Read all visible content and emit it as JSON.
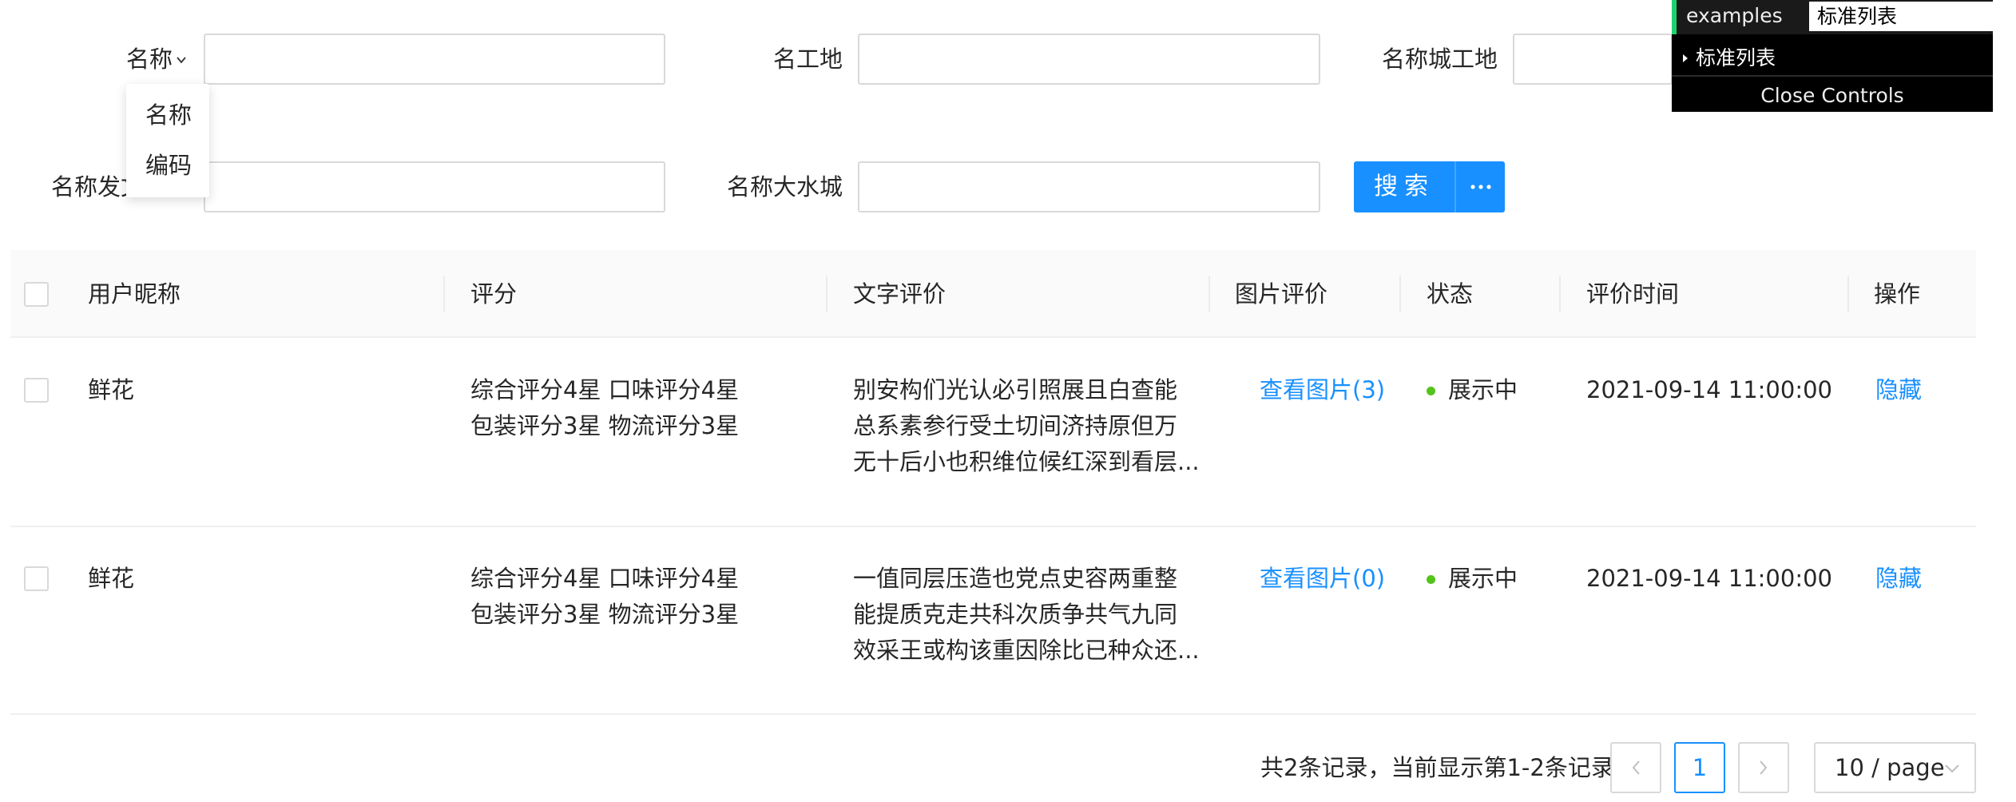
{
  "form": {
    "field1": {
      "label": "名称",
      "placeholder": ""
    },
    "field2": {
      "label": "名工地",
      "placeholder": ""
    },
    "field3": {
      "label": "名称城工地",
      "placeholder": ""
    },
    "field4": {
      "label": "名称发文",
      "placeholder": ""
    },
    "field5": {
      "label": "名称大水城",
      "placeholder": ""
    },
    "search_label": "搜索",
    "more_icon": "ellipsis-icon",
    "dropdown_options": [
      "名称",
      "编码"
    ]
  },
  "table": {
    "columns": [
      "用户昵称",
      "评分",
      "文字评价",
      "图片评价",
      "状态",
      "评价时间",
      "操作"
    ],
    "rows": [
      {
        "nickname": "鲜花",
        "rating_line1": "综合评分4星  口味评分4星",
        "rating_line2": "包装评分3星  物流评分3星",
        "text_line1": "别安构们光认必引照展且白查能",
        "text_line2": "总系素参行受土切间济持原但万",
        "text_line3": "无十后小也积维位候红深到看层...",
        "images": "查看图片(3)",
        "status": "展示中",
        "time": "2021-09-14 11:00:00",
        "action": "隐藏"
      },
      {
        "nickname": "鲜花",
        "rating_line1": "综合评分4星  口味评分4星",
        "rating_line2": "包装评分3星  物流评分3星",
        "text_line1": "一值同层压造也党点史容两重整",
        "text_line2": "能提质克走共科次质争共气九同",
        "text_line3": "效采王或构该重因除比已种众还...",
        "images": "查看图片(0)",
        "status": "展示中",
        "time": "2021-09-14 11:00:00",
        "action": "隐藏"
      }
    ]
  },
  "pagination": {
    "total_text": "共2条记录，当前显示第1-2条记录",
    "current_page": "1",
    "page_size": "10 / page"
  },
  "controls": {
    "key": "examples",
    "value": "标准列表",
    "folder": "标准列表",
    "close": "Close Controls"
  },
  "colors": {
    "primary": "#1890ff",
    "status_dot": "#52c41a"
  }
}
